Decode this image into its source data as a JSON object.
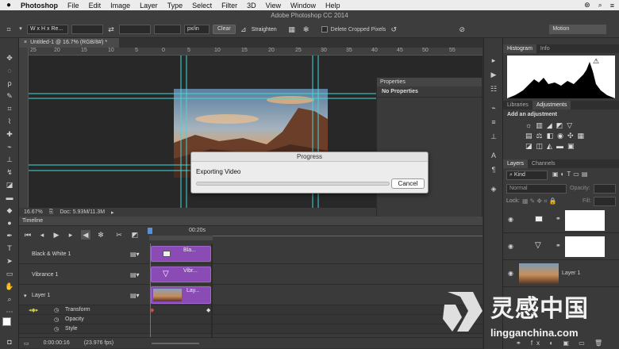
{
  "menubar": {
    "apple": "",
    "app": "Photoshop",
    "items": [
      "File",
      "Edit",
      "Image",
      "Layer",
      "Type",
      "Select",
      "Filter",
      "3D",
      "View",
      "Window",
      "Help"
    ],
    "right": [
      "⊛",
      "⌕",
      "≡"
    ]
  },
  "window_title": "Adobe Photoshop CC 2014",
  "options": {
    "ratio_select": "W x H x Re...",
    "unit_select": "px/in",
    "clear_label": "Clear",
    "straighten_label": "Straighten",
    "delete_cropped_label": "Delete Cropped Pixels",
    "workspace": "Motion"
  },
  "document": {
    "tab_label": "Untitled-1 @ 16.7% (RGB/8#) *",
    "zoom": "16.67%",
    "doc_size": "Doc: 5.93M/11.3M"
  },
  "ruler_top": [
    "25",
    "20",
    "15",
    "10",
    "5",
    "0",
    "5",
    "10",
    "15",
    "20",
    "25",
    "30",
    "35",
    "40",
    "45",
    "50",
    "55"
  ],
  "timeline": {
    "title": "Timeline",
    "time_label": "00:20s",
    "tracks": [
      {
        "name": "Black & White 1",
        "clip": "Bla..."
      },
      {
        "name": "Vibrance 1",
        "clip": "Vibr..."
      },
      {
        "name": "Layer 1",
        "clip": "Lay..."
      }
    ],
    "props": [
      "Transform",
      "Opacity",
      "Style"
    ],
    "timecode": "0:00:00:16",
    "fps": "(23.976 fps)"
  },
  "properties_panel": {
    "title": "Properties",
    "content": "No Properties"
  },
  "histogram_tabs": [
    "Histogram",
    "Info"
  ],
  "adjust_tabs": [
    "Libraries",
    "Adjustments"
  ],
  "adjust_title": "Add an adjustment",
  "layers_tabs": [
    "Layers",
    "Channels"
  ],
  "layers": {
    "kind": "Kind",
    "blend": "Normal",
    "opacity_label": "Opacity:",
    "lock_label": "Lock:",
    "fill_label": "Fill:",
    "items": [
      {
        "name": ""
      },
      {
        "name": ""
      },
      {
        "name": "Layer 1"
      }
    ]
  },
  "progress_dialog": {
    "title": "Progress",
    "message": "Exporting Video",
    "progress": 0,
    "cancel_label": "Cancel"
  },
  "watermark": {
    "cn": "灵感中国",
    "url": "lingganchina.com"
  }
}
